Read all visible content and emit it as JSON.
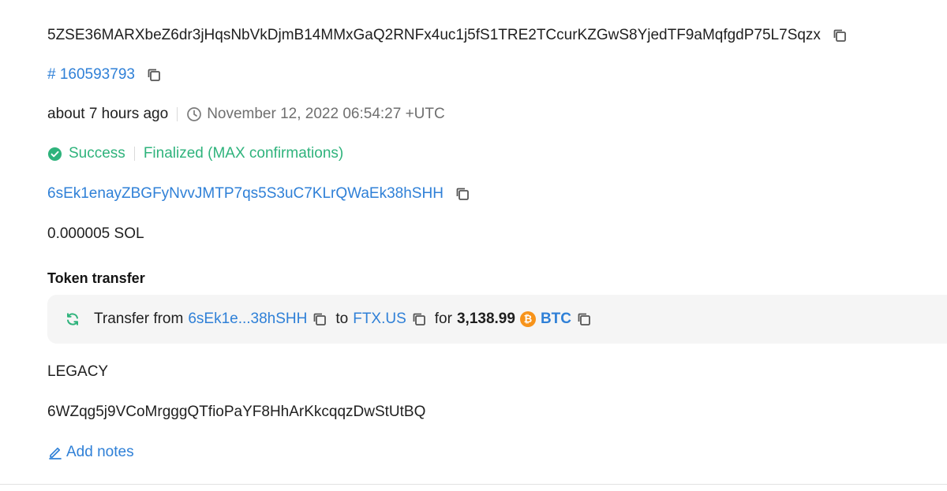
{
  "signature": "5ZSE36MARXbeZ6dr3jHqsNbVkDjmB14MMxGaQ2RNFx4uc1j5fS1TRE2TCcurKZGwS8YjedTF9aMqfgdP75L7Sqzx",
  "block": "# 160593793",
  "time": {
    "relative": "about 7 hours ago",
    "absolute": "November 12, 2022 06:54:27 +UTC"
  },
  "status": {
    "result": "Success",
    "confirmation": "Finalized (MAX confirmations)"
  },
  "signer": "6sEk1enayZBGFyNvvJMTP7qs5S3uC7KLrQWaEk38hSHH",
  "fee": "0.000005 SOL",
  "token_transfer": {
    "title": "Token transfer",
    "prefix": "Transfer from",
    "from": "6sEk1e...38hSHH",
    "to_label": "to",
    "to": "FTX.US",
    "for_label": "for",
    "amount": "3,138.99",
    "token": "BTC"
  },
  "version": "LEGACY",
  "recent_blockhash": "6WZqg5j9VCoMrgggQTfioPaYF8HhArKkcqqzDwStUtBQ",
  "notes_action": "Add notes",
  "colors": {
    "link": "#2f80d7",
    "success": "#2fb37c",
    "btc": "#f7931a"
  },
  "icons": [
    "copy-icon",
    "clock-icon",
    "check-circle-icon",
    "swap-icon",
    "bitcoin-icon",
    "pencil-icon"
  ]
}
